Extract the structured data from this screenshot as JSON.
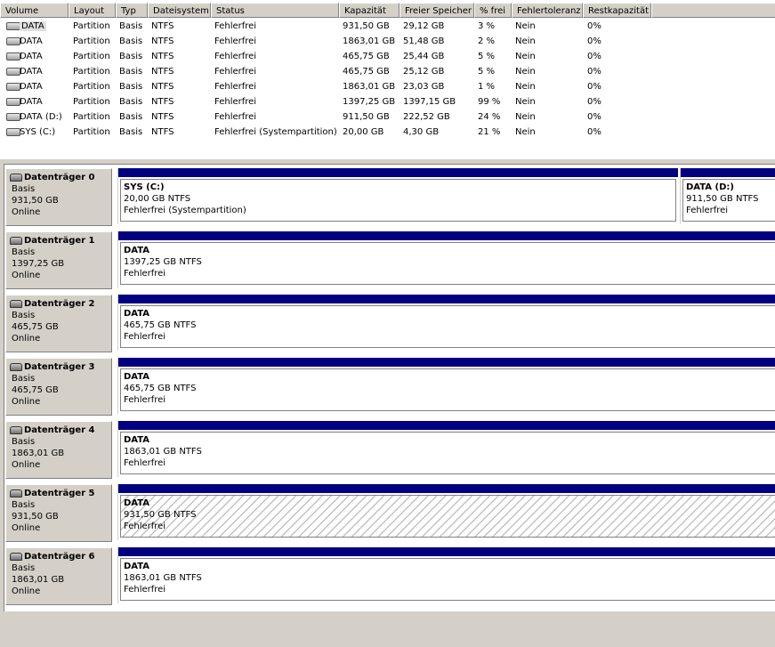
{
  "columns": [
    "Volume",
    "Layout",
    "Typ",
    "Dateisystem",
    "Status",
    "Kapazität",
    "Freier Speicher",
    "% frei",
    "Fehlertoleranz",
    "Restkapazität"
  ],
  "volumes": [
    {
      "name": "DATA",
      "layout": "Partition",
      "typ": "Basis",
      "fs": "NTFS",
      "status": "Fehlerfrei",
      "kapazitaet": "931,50 GB",
      "frei": "29,12 GB",
      "pfrei": "3 %",
      "ft": "Nein",
      "rest": "0%"
    },
    {
      "name": "DATA",
      "layout": "Partition",
      "typ": "Basis",
      "fs": "NTFS",
      "status": "Fehlerfrei",
      "kapazitaet": "1863,01 GB",
      "frei": "51,48 GB",
      "pfrei": "2 %",
      "ft": "Nein",
      "rest": "0%"
    },
    {
      "name": "DATA",
      "layout": "Partition",
      "typ": "Basis",
      "fs": "NTFS",
      "status": "Fehlerfrei",
      "kapazitaet": "465,75 GB",
      "frei": "25,44 GB",
      "pfrei": "5 %",
      "ft": "Nein",
      "rest": "0%"
    },
    {
      "name": "DATA",
      "layout": "Partition",
      "typ": "Basis",
      "fs": "NTFS",
      "status": "Fehlerfrei",
      "kapazitaet": "465,75 GB",
      "frei": "25,12 GB",
      "pfrei": "5 %",
      "ft": "Nein",
      "rest": "0%"
    },
    {
      "name": "DATA",
      "layout": "Partition",
      "typ": "Basis",
      "fs": "NTFS",
      "status": "Fehlerfrei",
      "kapazitaet": "1863,01 GB",
      "frei": "23,03 GB",
      "pfrei": "1 %",
      "ft": "Nein",
      "rest": "0%"
    },
    {
      "name": "DATA",
      "layout": "Partition",
      "typ": "Basis",
      "fs": "NTFS",
      "status": "Fehlerfrei",
      "kapazitaet": "1397,25 GB",
      "frei": "1397,15 GB",
      "pfrei": "99 %",
      "ft": "Nein",
      "rest": "0%"
    },
    {
      "name": "DATA (D:)",
      "layout": "Partition",
      "typ": "Basis",
      "fs": "NTFS",
      "status": "Fehlerfrei",
      "kapazitaet": "911,50 GB",
      "frei": "222,52 GB",
      "pfrei": "24 %",
      "ft": "Nein",
      "rest": "0%"
    },
    {
      "name": "SYS (C:)",
      "layout": "Partition",
      "typ": "Basis",
      "fs": "NTFS",
      "status": "Fehlerfrei (Systempartition)",
      "kapazitaet": "20,00 GB",
      "frei": "4,30 GB",
      "pfrei": "21 %",
      "ft": "Nein",
      "rest": "0%"
    }
  ],
  "disks": [
    {
      "title": "Datenträger 0",
      "type": "Basis",
      "size": "931,50 GB",
      "state": "Online",
      "partitions": [
        {
          "name": "SYS  (C:)",
          "size": "20,00 GB NTFS",
          "status": "Fehlerfrei (Systempartition)",
          "hatched": false
        },
        {
          "name": "DATA  (D:)",
          "size": "911,50 GB NTFS",
          "status": "Fehlerfrei",
          "hatched": false
        }
      ]
    },
    {
      "title": "Datenträger 1",
      "type": "Basis",
      "size": "1397,25 GB",
      "state": "Online",
      "partitions": [
        {
          "name": "DATA",
          "size": "1397,25 GB NTFS",
          "status": "Fehlerfrei",
          "hatched": false
        }
      ]
    },
    {
      "title": "Datenträger 2",
      "type": "Basis",
      "size": "465,75 GB",
      "state": "Online",
      "partitions": [
        {
          "name": "DATA",
          "size": "465,75 GB NTFS",
          "status": "Fehlerfrei",
          "hatched": false
        }
      ]
    },
    {
      "title": "Datenträger 3",
      "type": "Basis",
      "size": "465,75 GB",
      "state": "Online",
      "partitions": [
        {
          "name": "DATA",
          "size": "465,75 GB NTFS",
          "status": "Fehlerfrei",
          "hatched": false
        }
      ]
    },
    {
      "title": "Datenträger 4",
      "type": "Basis",
      "size": "1863,01 GB",
      "state": "Online",
      "partitions": [
        {
          "name": "DATA",
          "size": "1863,01 GB NTFS",
          "status": "Fehlerfrei",
          "hatched": false
        }
      ]
    },
    {
      "title": "Datenträger 5",
      "type": "Basis",
      "size": "931,50 GB",
      "state": "Online",
      "partitions": [
        {
          "name": "DATA",
          "size": "931,50 GB NTFS",
          "status": "Fehlerfrei",
          "hatched": true
        }
      ]
    },
    {
      "title": "Datenträger 6",
      "type": "Basis",
      "size": "1863,01 GB",
      "state": "Online",
      "partitions": [
        {
          "name": "DATA",
          "size": "1863,01 GB NTFS",
          "status": "Fehlerfrei",
          "hatched": false
        }
      ]
    }
  ],
  "colors": {
    "bar": "#000080",
    "face": "#d4d0c8"
  }
}
